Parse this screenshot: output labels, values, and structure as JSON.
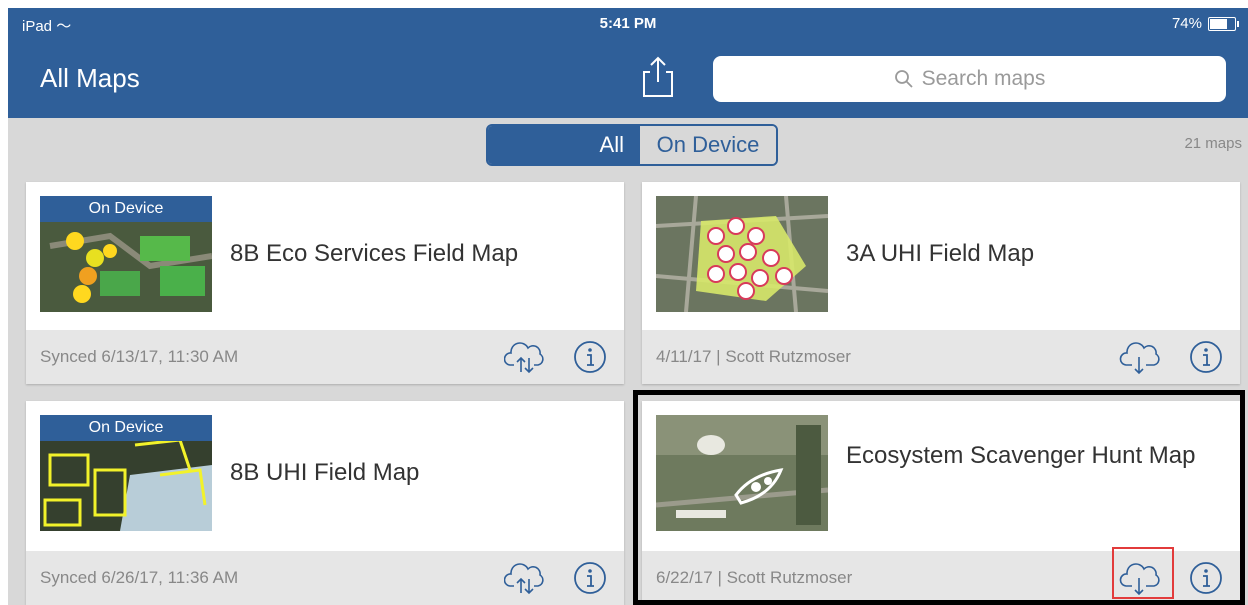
{
  "status_bar": {
    "device": "iPad",
    "time": "5:41 PM",
    "battery": "74%",
    "battery_level": 0.74
  },
  "nav": {
    "title": "All Maps",
    "share_icon": "share-icon",
    "search_placeholder": "Search maps",
    "search_icon": "search-icon"
  },
  "filter": {
    "options": [
      "All",
      "On Device"
    ],
    "selected": "All",
    "count": "21 maps"
  },
  "maps": [
    {
      "title": "8B Eco Services Field Map",
      "badge": "On Device",
      "meta": "Synced 6/13/17, 11:30 AM",
      "action_icon": "cloud-sync-icon"
    },
    {
      "title": "3A UHI Field Map",
      "badge": "",
      "meta": "4/11/17 | Scott Rutzmoser",
      "action_icon": "cloud-download-icon"
    },
    {
      "title": "8B UHI Field Map",
      "badge": "On Device",
      "meta": "Synced 6/26/17, 11:36 AM",
      "action_icon": "cloud-sync-icon"
    },
    {
      "title": "Ecosystem Scavenger Hunt Map",
      "badge": "",
      "meta": "6/22/17 | Scott Rutzmoser",
      "action_icon": "cloud-download-icon"
    }
  ],
  "colors": {
    "brand": "#2f5f99",
    "toolbar_bg": "#d8d8d8",
    "highlight": "#000000",
    "focus_box": "#e23b3b"
  }
}
